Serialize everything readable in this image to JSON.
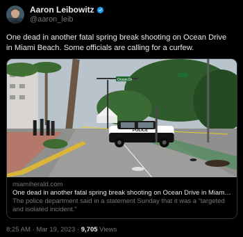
{
  "author": {
    "display_name": "Aaron Leibowitz",
    "handle": "@aaron_leib",
    "verified": true
  },
  "tweet": {
    "text": "One dead in another fatal spring break shooting on Ocean Drive in Miami Beach. Some officials are calling for a curfew."
  },
  "card": {
    "domain": "miamiherald.com",
    "title": "One dead in another fatal spring break shooting on Ocean Drive in Miami Bea…",
    "description": "The police department said in a statement Sunday that it was a “targeted and isolated incident.”",
    "image": {
      "police_car_text": "POLICE",
      "street_sign_text": "Ocean Dr"
    }
  },
  "footer": {
    "time": "8:25 AM",
    "separator": "·",
    "date": "Mar 19, 2023",
    "views_count": "9,705",
    "views_label": "Views"
  },
  "colors": {
    "background": "#000000",
    "text_primary": "#e7e9ea",
    "text_secondary": "#71767b",
    "verified_blue": "#1d9bf0",
    "card_border": "#2f3336"
  }
}
